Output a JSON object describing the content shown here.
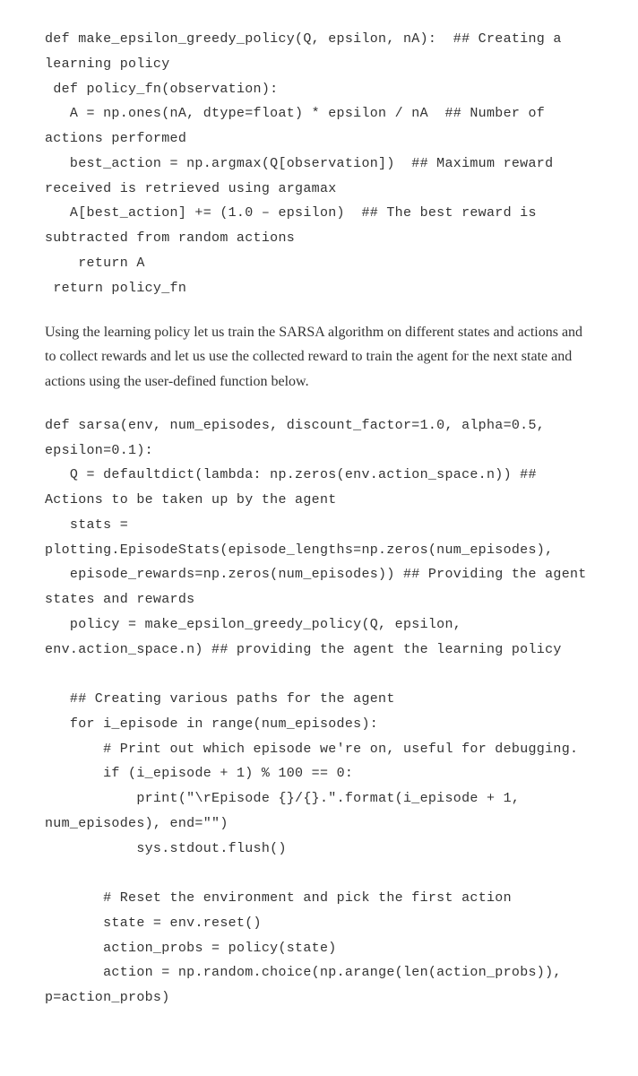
{
  "code_block_1": "def make_epsilon_greedy_policy(Q, epsilon, nA):  ## Creating a learning policy\n def policy_fn(observation):\n   A = np.ones(nA, dtype=float) * epsilon / nA  ## Number of actions performed\n   best_action = np.argmax(Q[observation])  ## Maximum reward received is retrieved using argamax\n   A[best_action] += (1.0 – epsilon)  ## The best reward is subtracted from random actions\n    return A\n return policy_fn",
  "paragraph_1": "Using the learning policy let us train the SARSA algorithm on different states and actions and to collect rewards and let us use the collected reward to train the agent for the next state and actions using the user-defined function below.",
  "code_block_2": "def sarsa(env, num_episodes, discount_factor=1.0, alpha=0.5, epsilon=0.1):\n   Q = defaultdict(lambda: np.zeros(env.action_space.n)) ## Actions to be taken up by the agent\n   stats = plotting.EpisodeStats(episode_lengths=np.zeros(num_episodes),\n   episode_rewards=np.zeros(num_episodes)) ## Providing the agent states and rewards\n   policy = make_epsilon_greedy_policy(Q, epsilon, env.action_space.n) ## providing the agent the learning policy\n\n   ## Creating various paths for the agent\n   for i_episode in range(num_episodes):\n       # Print out which episode we're on, useful for debugging.\n       if (i_episode + 1) % 100 == 0:\n           print(\"\\rEpisode {}/{}.\".format(i_episode + 1, num_episodes), end=\"\")\n           sys.stdout.flush()\n\n       # Reset the environment and pick the first action\n       state = env.reset()\n       action_probs = policy(state)\n       action = np.random.choice(np.arange(len(action_probs)), p=action_probs)"
}
